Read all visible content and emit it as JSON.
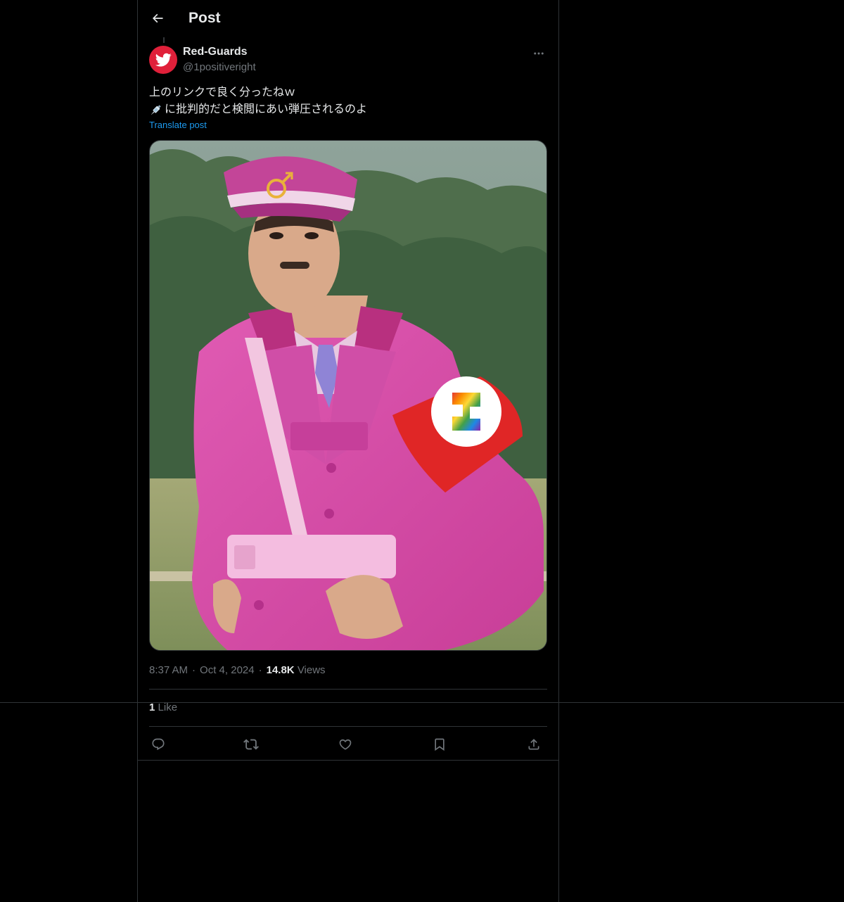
{
  "header": {
    "title": "Post",
    "back_icon": "arrow-left-icon"
  },
  "author": {
    "display_name": "Red-Guards",
    "handle": "@1positiveright",
    "avatar_color": "#e0203a",
    "avatar_icon": "bird-icon"
  },
  "post": {
    "lines": [
      "上のリンクで良く分ったねｗ",
      "に批判的だと検閲にあい弾圧されるのよ"
    ],
    "emoji": "syringe-icon",
    "translate_label": "Translate post"
  },
  "meta": {
    "time": "8:37 AM",
    "date": "Oct 4, 2024",
    "views_count": "14.8K",
    "views_label": "Views"
  },
  "likes": {
    "count": "1",
    "label": "Like"
  },
  "actions": [
    "reply-icon",
    "repost-icon",
    "like-icon",
    "bookmark-icon",
    "share-icon"
  ],
  "colors": {
    "background": "#000000",
    "text": "#e7e9ea",
    "muted": "#71767b",
    "link": "#1d9bf0",
    "border": "#2f3336"
  }
}
